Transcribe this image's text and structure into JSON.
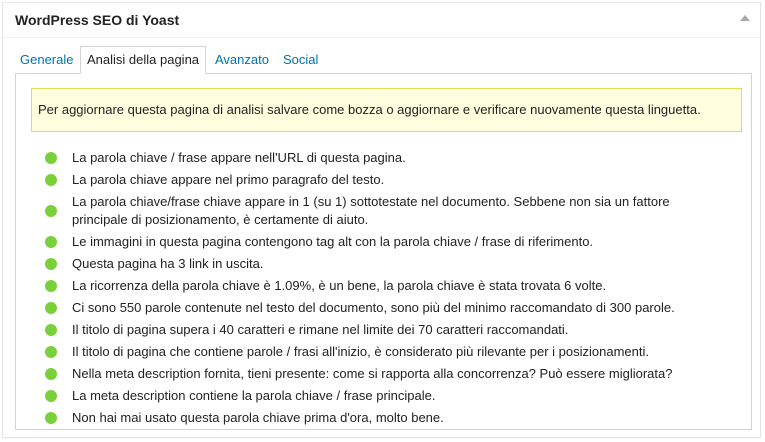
{
  "box": {
    "title": "WordPress SEO di Yoast"
  },
  "tabs": [
    {
      "label": "Generale",
      "active": false
    },
    {
      "label": "Analisi della pagina",
      "active": true
    },
    {
      "label": "Avanzato",
      "active": false
    },
    {
      "label": "Social",
      "active": false
    }
  ],
  "notice": {
    "text": "Per aggiornare questa pagina di analisi salvare come bozza o aggiornare e verificare nuovamente questa linguetta."
  },
  "colors": {
    "good": "#7ad03a",
    "notice_bg": "#ffffe0",
    "link": "#0073aa"
  },
  "results": [
    {
      "status": "good",
      "text": "La parola chiave / frase appare nell'URL di questa pagina."
    },
    {
      "status": "good",
      "text": "La parola chiave appare nel primo paragrafo del testo."
    },
    {
      "status": "good",
      "text": "La parola chiave/frase chiave appare in 1 (su 1) sottotestate nel documento. Sebbene non sia un fattore principale di posizionamento, è certamente di aiuto."
    },
    {
      "status": "good",
      "text": "Le immagini in questa pagina contengono tag alt con la parola chiave / frase di riferimento."
    },
    {
      "status": "good",
      "text": "Questa pagina ha 3 link in uscita."
    },
    {
      "status": "good",
      "text": "La ricorrenza della parola chiave è 1.09%, è un bene, la parola chiave è stata trovata 6 volte."
    },
    {
      "status": "good",
      "text": "Ci sono 550 parole contenute nel testo del documento, sono più del minimo raccomandato di 300 parole."
    },
    {
      "status": "good",
      "text": "Il titolo di pagina supera i 40 caratteri e rimane nel limite dei 70 caratteri raccomandati."
    },
    {
      "status": "good",
      "text": "Il titolo di pagina che contiene parole / frasi all'inizio, è considerato più rilevante per i posizionamenti."
    },
    {
      "status": "good",
      "text": "Nella meta description fornita, tieni presente: come si rapporta alla concorrenza? Può essere migliorata?"
    },
    {
      "status": "good",
      "text": "La meta description contiene la parola chiave / frase principale."
    },
    {
      "status": "good",
      "text": "Non hai mai usato questa parola chiave prima d'ora, molto bene."
    }
  ]
}
